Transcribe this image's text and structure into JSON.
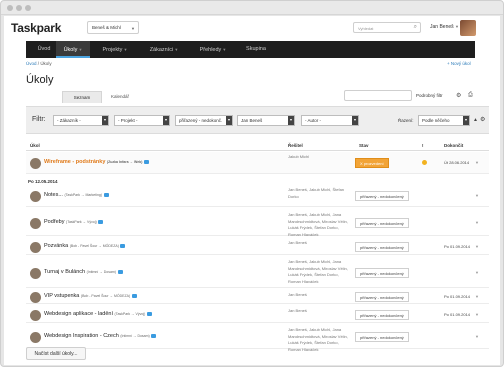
{
  "header": {
    "logo": "Taskpark",
    "project_select": "Beneš & Michl",
    "search_placeholder": "Vyhledat",
    "user_name": "Jan Beneš"
  },
  "nav": {
    "items": [
      {
        "label": "Úvod",
        "active": false,
        "caret": false
      },
      {
        "label": "Úkoly",
        "active": true,
        "caret": true
      },
      {
        "label": "Projekty",
        "active": false,
        "caret": true
      },
      {
        "label": "Zákazníci",
        "active": false,
        "caret": true
      },
      {
        "label": "Přehledy",
        "active": false,
        "caret": true
      },
      {
        "label": "Skupina",
        "active": false,
        "caret": false
      }
    ]
  },
  "breadcrumb": {
    "home": "Úvod",
    "sep": "/",
    "current": "Úkoly"
  },
  "new_task": "+ Nový úkol",
  "page_title": "Úkoly",
  "tabs": [
    "Seznam",
    "Kalendář"
  ],
  "sub_filter": "Podrobný filtr",
  "filter": {
    "label": "Filtr:",
    "customer": "- Zákazník -",
    "project": "- Projekt -",
    "status": "přiřazený - nedokonč.",
    "user": "Jan Beneš",
    "author": "- Autor -",
    "sort_label": "Řazení:",
    "sort_value": "Podle něčeho"
  },
  "columns": [
    "Úkol",
    "Řešitel",
    "Stav",
    "!",
    "Dokončit"
  ],
  "date_group": "Po 12.05.2014",
  "tasks": [
    {
      "name": "Wireframe - podstránky",
      "sub": "(Zuzka Infara → Web)",
      "resolvers": "Jakub Michl",
      "status": "X prozvedení",
      "status_orange": true,
      "flag": true,
      "due": "Út 28.06.2014",
      "orange": true
    },
    {
      "name": "Notes...",
      "sub": "(TaskPark → Marketing)",
      "resolvers": "Jan Beneš, Jakub Michl, Štefan Dorko",
      "status": "přiřazený - nedokončený",
      "status_orange": false,
      "flag": false,
      "due": "",
      "orange": false
    },
    {
      "name": "Podřeby",
      "sub": "(TaskPark → Vývoj)",
      "resolvers": "Jan Beneš, Jakub Michl, Jana Mandrschmidtová, Miroslav Vélin, Lukáš Frýdek, Štefan Dorko, Roman Hlaváček",
      "status": "přiřazený - nedokončený",
      "status_orange": false,
      "flag": false,
      "due": "",
      "orange": false
    },
    {
      "name": "Pozvánka",
      "sub": "(Bob - Pavel Šour → MÓDEZA)",
      "resolvers": "Jan Beneš",
      "status": "přiřazený - nedokončený",
      "status_orange": false,
      "flag": false,
      "due": "Po 01.09.2014",
      "orange": false
    },
    {
      "name": "Turnaj v Bulánch",
      "sub": "(Intimní → Dosam)",
      "resolvers": "Jan Beneš, Jakub Michl, Jana Mandrschmidtová, Miroslav Vélin, Lukáš Frýdek, Štefan Dorko, Roman Hlaváček",
      "status": "přiřazený - nedokončený",
      "status_orange": false,
      "flag": false,
      "due": "",
      "orange": false
    },
    {
      "name": "VIP vstupenka",
      "sub": "(Bob - Pavel Šour → MÓDEZA)",
      "resolvers": "Jan Beneš",
      "status": "přiřazený - nedokončený",
      "status_orange": false,
      "flag": false,
      "due": "Po 01.09.2014",
      "orange": false
    },
    {
      "name": "Webdesign aplikace - ladění",
      "sub": "(TaskPark → Vývoj)",
      "resolvers": "Jan Beneš",
      "status": "přiřazený - nedokončený",
      "status_orange": false,
      "flag": false,
      "due": "Po 01.09.2014",
      "orange": false
    },
    {
      "name": "Webdesign Inspiration - Czech",
      "sub": "(Intimní → Dosam)",
      "resolvers": "Jan Beneš, Jakub Michl, Jana Mandrschmidtová, Miroslav Vélin, Lukáš Frýdek, Štefan Dorko, Roman Hlaváček",
      "status": "přiřazený - nedokončený",
      "status_orange": false,
      "flag": false,
      "due": "",
      "orange": false
    }
  ],
  "load_more": "Načíst další úkoly..."
}
